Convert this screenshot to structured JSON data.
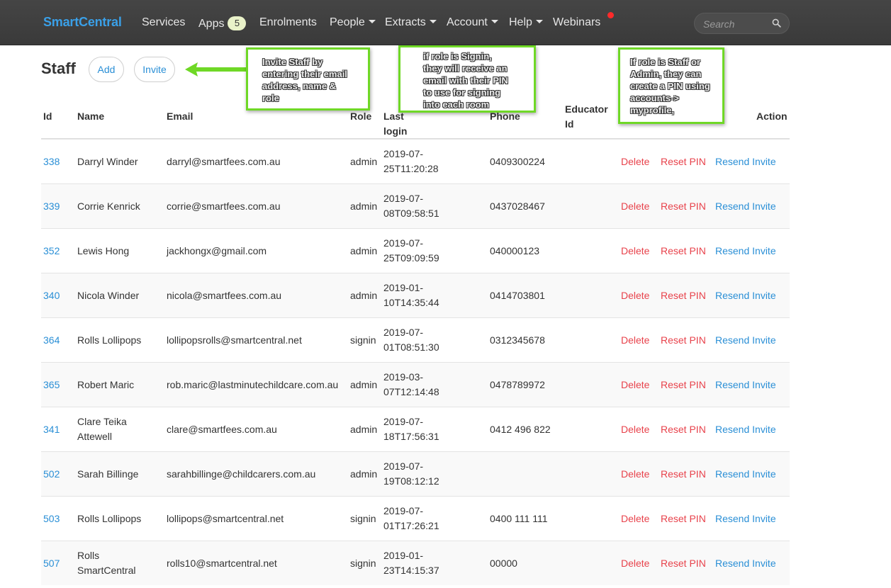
{
  "nav": {
    "brand": "SmartCentral",
    "items": [
      {
        "label": "Services",
        "caret": false
      },
      {
        "label": "Apps",
        "badge": "5"
      },
      {
        "label": "Enrolments",
        "caret": false
      },
      {
        "label": "People",
        "caret": true
      },
      {
        "label": "Extracts",
        "caret": true
      },
      {
        "label": "Account",
        "caret": true
      },
      {
        "label": "Help",
        "caret": true
      },
      {
        "label": "Webinars",
        "caret": false
      }
    ],
    "search_placeholder": "Search",
    "colors": {
      "bar": "#3f3f3f",
      "brand": "#3aa0e8",
      "notification": "#ff2a2a"
    }
  },
  "page": {
    "title": "Staff",
    "add_label": "Add",
    "invite_label": "Invite"
  },
  "callouts": [
    {
      "lines": [
        "Invite Staff by",
        "entering their email",
        "address, name &",
        "role"
      ]
    },
    {
      "lines": [
        "if role is Signin,",
        "they will receive an",
        "email with their PIN",
        "to use for signing",
        "into each room"
      ]
    },
    {
      "lines": [
        "If role is Staff or",
        "Admin, they can",
        "create a PIN using",
        "accounts->",
        "myprofile,"
      ]
    }
  ],
  "table": {
    "headers": {
      "id": "Id",
      "name": "Name",
      "email": "Email",
      "role": "Role",
      "last_login": "Last login",
      "phone": "Phone",
      "educator_1": "Educator",
      "educator_2": "Id",
      "action": "Action"
    },
    "action_labels": {
      "delete": "Delete",
      "reset": "Reset PIN",
      "resend": "Resend Invite"
    },
    "rows": [
      {
        "id": "338",
        "name1": "Darryl Winder",
        "name2": "",
        "email": "darryl@smartfees.com.au",
        "role": "admin",
        "login1": "2019-07-",
        "login2": "25T11:20:28",
        "phone": "0409300224"
      },
      {
        "id": "339",
        "name1": "Corrie Kenrick",
        "name2": "",
        "email": "corrie@smartfees.com.au",
        "role": "admin",
        "login1": "2019-07-",
        "login2": "08T09:58:51",
        "phone": "0437028467"
      },
      {
        "id": "352",
        "name1": "Lewis Hong",
        "name2": "",
        "email": "jackhongx@gmail.com",
        "role": "admin",
        "login1": "2019-07-",
        "login2": "25T09:09:59",
        "phone": "040000123"
      },
      {
        "id": "340",
        "name1": "Nicola Winder",
        "name2": "",
        "email": "nicola@smartfees.com.au",
        "role": "admin",
        "login1": "2019-01-",
        "login2": "10T14:35:44",
        "phone": "0414703801"
      },
      {
        "id": "364",
        "name1": "Rolls Lollipops",
        "name2": "",
        "email": "lollipopsrolls@smartcentral.net",
        "role": "signin",
        "login1": "2019-07-",
        "login2": "01T08:51:30",
        "phone": "0312345678"
      },
      {
        "id": "365",
        "name1": "Robert Maric",
        "name2": "",
        "email": "rob.maric@lastminutechildcare.com.au",
        "role": "admin",
        "login1": "2019-03-",
        "login2": "07T12:14:48",
        "phone": "0478789972"
      },
      {
        "id": "341",
        "name1": "Clare Teika",
        "name2": "Attewell",
        "email": "clare@smartfees.com.au",
        "role": "admin",
        "login1": "2019-07-",
        "login2": "18T17:56:31",
        "phone": "0412 496 822"
      },
      {
        "id": "502",
        "name1": "Sarah Billinge",
        "name2": "",
        "email": "sarahbillinge@childcarers.com.au",
        "role": "admin",
        "login1": "2019-07-",
        "login2": "19T08:12:12",
        "phone": ""
      },
      {
        "id": "503",
        "name1": "Rolls Lollipops",
        "name2": "",
        "email": "lollipops@smartcentral.net",
        "role": "signin",
        "login1": "2019-07-",
        "login2": "01T17:26:21",
        "phone": "0400 111 111"
      },
      {
        "id": "507",
        "name1": "Rolls",
        "name2": "SmartCentral",
        "email": "rolls10@smartcentral.net",
        "role": "signin",
        "login1": "2019-01-",
        "login2": "23T14:15:37",
        "phone": "00000"
      }
    ]
  }
}
